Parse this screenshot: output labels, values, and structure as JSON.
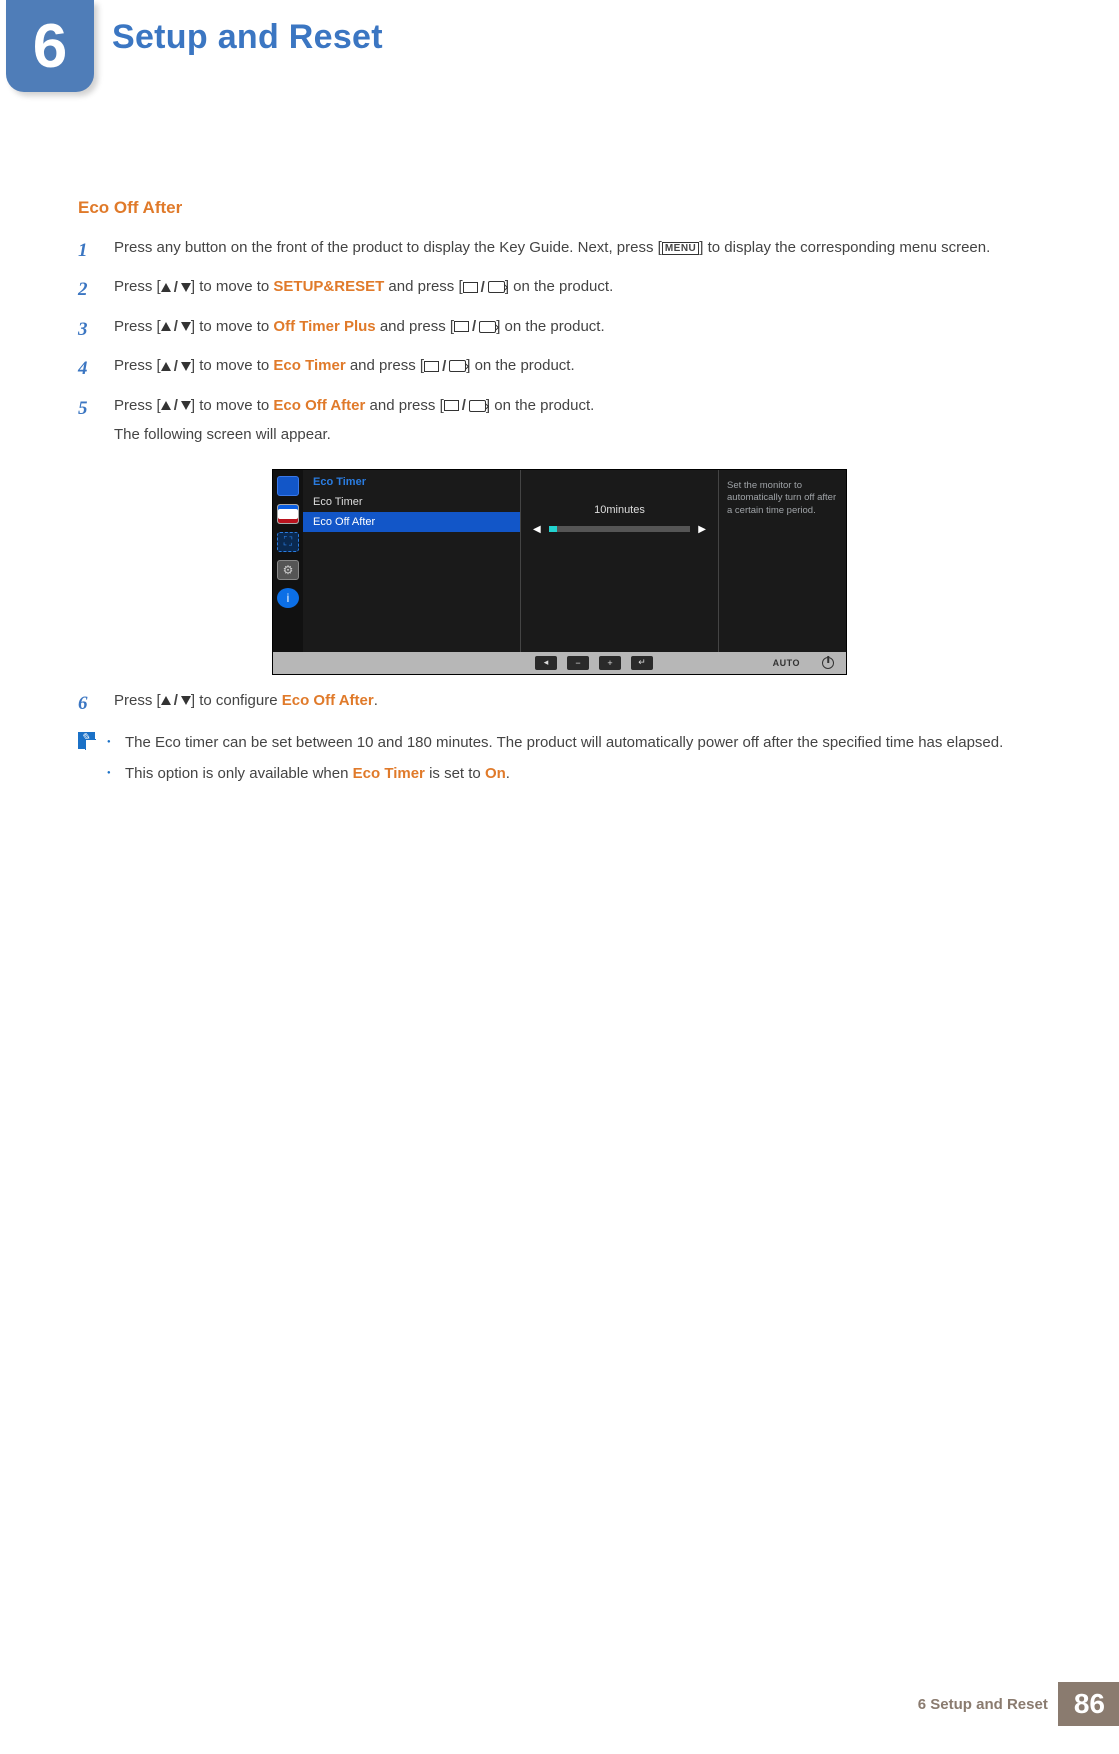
{
  "chapter": {
    "number": "6",
    "title": "Setup and Reset"
  },
  "section_title": "Eco Off After",
  "steps": [
    {
      "num": "1",
      "pre": "Press any button on the front of the product to display the Key Guide. Next, press [",
      "menu": "MENU",
      "post": "] to display the corresponding menu screen."
    },
    {
      "num": "2",
      "pre": "Press [",
      "mid": "] to move to ",
      "kw": "SETUP&RESET",
      "post1": " and press [",
      "post2": "] on the product."
    },
    {
      "num": "3",
      "pre": "Press [",
      "mid": "] to move to ",
      "kw": "Off Timer Plus",
      "post1": " and press [",
      "post2": "] on the product."
    },
    {
      "num": "4",
      "pre": "Press [",
      "mid": "] to move to ",
      "kw": "Eco Timer",
      "post1": "  and press [",
      "post2": "] on the product."
    },
    {
      "num": "5",
      "pre": "Press [",
      "mid": "] to move to ",
      "kw": "Eco Off After",
      "post1": " and press [",
      "post2": "] on the product.",
      "extra": "The following screen will appear."
    },
    {
      "num": "6",
      "pre": "Press [",
      "mid": "] to configure ",
      "kw": "Eco Off After",
      "post": "."
    }
  ],
  "osd": {
    "menu_title": "Eco Timer",
    "items": [
      {
        "label": "Eco Timer",
        "selected": false
      },
      {
        "label": "Eco Off After",
        "selected": true
      }
    ],
    "value_label": "10minutes",
    "side_text": "Set the monitor to automatically turn off after a certain time period.",
    "bottom": {
      "auto": "AUTO"
    }
  },
  "notes": [
    {
      "text_a": "The Eco timer can be set between 10 and 180 minutes. The product will automatically power off after the specified time has elapsed."
    },
    {
      "text_a": "This option is only available when ",
      "kw1": "Eco Timer",
      "mid": " is set to ",
      "kw2": "On",
      "post": "."
    }
  ],
  "footer": {
    "label": "6 Setup and Reset",
    "page": "86"
  }
}
